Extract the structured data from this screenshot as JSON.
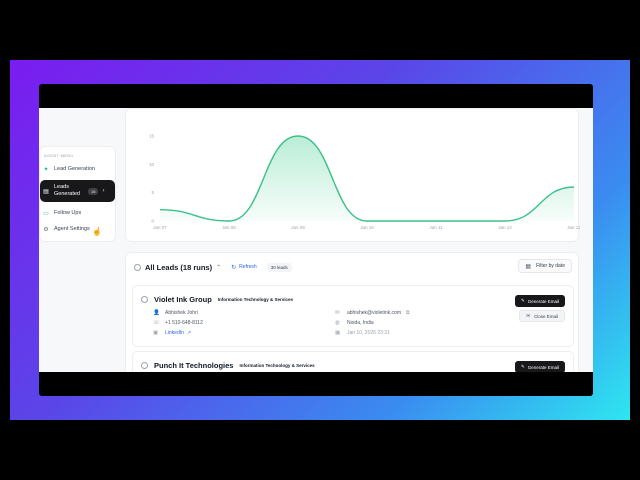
{
  "sidebar": {
    "title": "AGENT MENU",
    "items": [
      {
        "label": "Lead Generation",
        "icon": "sparkle-icon"
      },
      {
        "label": "Leads Generated",
        "icon": "document-icon",
        "badge": "16"
      },
      {
        "label": "Follow Ups",
        "icon": "chat-icon"
      },
      {
        "label": "Agent Settings",
        "icon": "gear-icon"
      }
    ]
  },
  "chart_data": {
    "type": "area",
    "x": [
      "Jan 07",
      "Jan 08",
      "Jan 09",
      "Jan 10",
      "Jan 11",
      "Jan 12",
      "Jan 13"
    ],
    "values": [
      2,
      0,
      15,
      0,
      0,
      0,
      6
    ],
    "yticks": [
      "0",
      "5",
      "10",
      "15"
    ],
    "ylim": [
      0,
      18
    ],
    "grid": false,
    "colors": {
      "line": "#3cc08a",
      "fill": "#b6ecd4"
    }
  },
  "leads": {
    "title": "All Leads (18 runs)",
    "refresh_label": "Refresh",
    "count_label": "30 leads",
    "filter_label": "Filter by date",
    "items": [
      {
        "company": "Violet Ink Group",
        "industry": "Information Technology & Services",
        "contact": "Abhishek Johri",
        "phone": "+1 510-648-8112",
        "linkedin": "LinkedIn",
        "email": "abhishek@violetink.com",
        "location": "Noida, India",
        "date": "Jan 10, 2026 23:31",
        "generate_label": "Generate Email",
        "close_label": "Close Email"
      },
      {
        "company": "Punch It Technologies",
        "industry": "Information Technology & Services",
        "generate_label": "Generate Email"
      }
    ]
  }
}
